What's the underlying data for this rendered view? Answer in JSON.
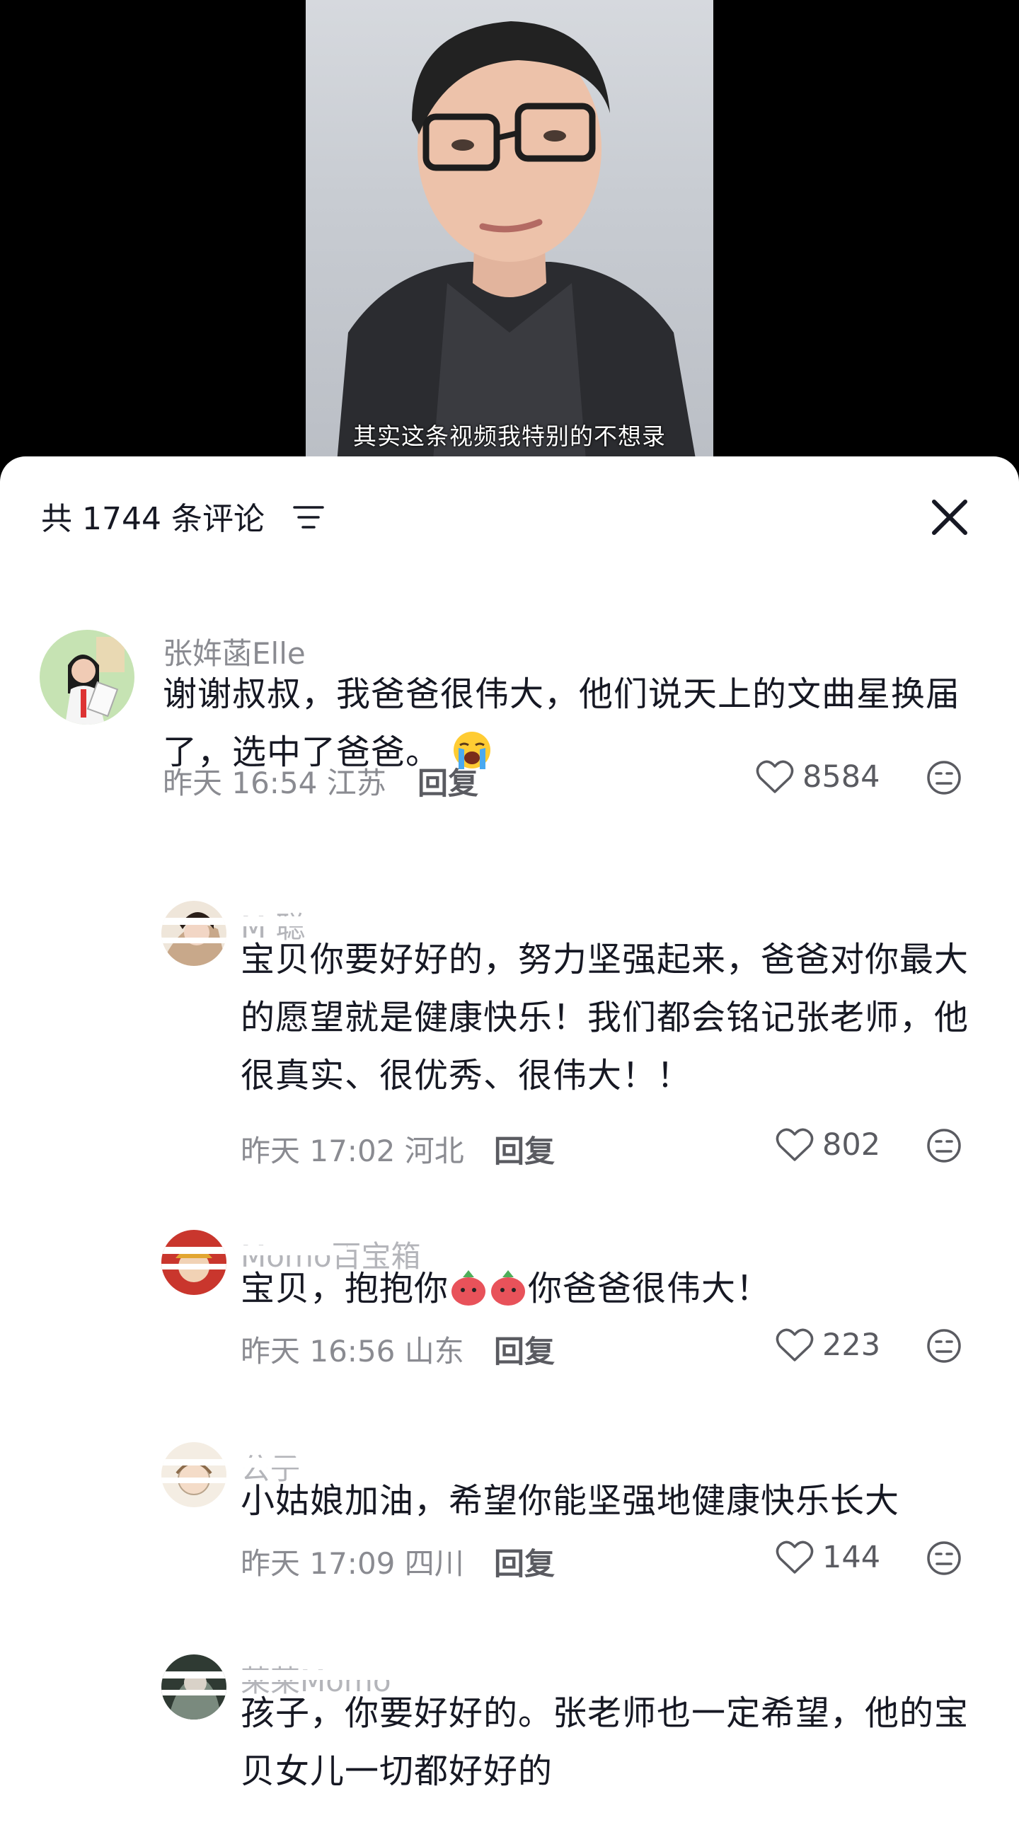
{
  "video": {
    "subtitle": "其实这条视频我特别的不想录"
  },
  "header": {
    "comment_count": "共 1744 条评论",
    "sort_icon": "sort-lines-icon",
    "close_icon": "close-x-icon"
  },
  "comments": [
    {
      "username": "张姩菡Elle",
      "text": "谢谢叔叔，我爸爸很伟大，他们说天上的文曲星换届了，选中了爸爸。",
      "emoji": "loudly-crying-face",
      "time": "昨天 16:54",
      "location": "江苏",
      "reply_label": "回复",
      "likes": "8584"
    },
    {
      "username": "M  聪",
      "text": "宝贝你要好好的，努力坚强起来，爸爸对你最大的愿望就是健康快乐！我们都会铭记张老师，他很真实、很优秀、很伟大！！",
      "time": "昨天 17:02",
      "location": "河北",
      "reply_label": "回复",
      "likes": "802"
    },
    {
      "username": "Momo百宝箱",
      "text_before": "宝贝，抱抱你",
      "emoji": "hug-emoji",
      "text_after": "你爸爸很伟大！",
      "time": "昨天 16:56",
      "location": "山东",
      "reply_label": "回复",
      "likes": "223"
    },
    {
      "username": "公子",
      "text": "小姑娘加油，希望你能坚强地健康快乐长大",
      "time": "昨天 17:09",
      "location": "四川",
      "reply_label": "回复",
      "likes": "144"
    },
    {
      "username": "莱莱Momo",
      "text": "孩子，你要好好的。张老师也一定希望，他的宝贝女儿一切都好好的"
    }
  ],
  "colors": {
    "text_primary": "#161823",
    "text_secondary": "#8a8b91",
    "background": "#ffffff",
    "video_bg": "#000000"
  }
}
